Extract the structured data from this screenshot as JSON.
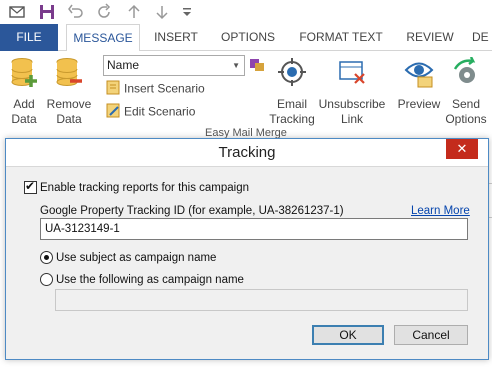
{
  "tabs": {
    "file": "FILE",
    "message": "MESSAGE",
    "insert": "INSERT",
    "options": "OPTIONS",
    "format_text": "FORMAT TEXT",
    "review": "REVIEW",
    "developer_truncated": "DE"
  },
  "ribbon": {
    "add_data": [
      "Add",
      "Data"
    ],
    "remove_data": [
      "Remove",
      "Data"
    ],
    "name_combo_value": "Name",
    "insert_scenario": "Insert Scenario",
    "edit_scenario": "Edit Scenario",
    "email_tracking": [
      "Email",
      "Tracking"
    ],
    "unsubscribe_link": [
      "Unsubscribe",
      "Link"
    ],
    "preview": "Preview",
    "send_options": [
      "Send",
      "Options"
    ],
    "group_label": "Easy Mail Merge"
  },
  "dialog": {
    "title": "Tracking",
    "close_glyph": "✕",
    "enable_tracking_label": "Enable tracking reports for this campaign",
    "enable_tracking_checked": true,
    "property_id_label": "Google Property Tracking ID (for example, UA-38261237-1)",
    "learn_more": "Learn More",
    "property_id_value": "UA-3123149-1",
    "use_subject_label": "Use subject as campaign name",
    "use_following_label": "Use the following as campaign name",
    "campaign_name_value": "",
    "ok_label": "OK",
    "cancel_label": "Cancel"
  },
  "colors": {
    "accent": "#2b579a",
    "close": "#c42b1c",
    "link": "#0645ad"
  }
}
